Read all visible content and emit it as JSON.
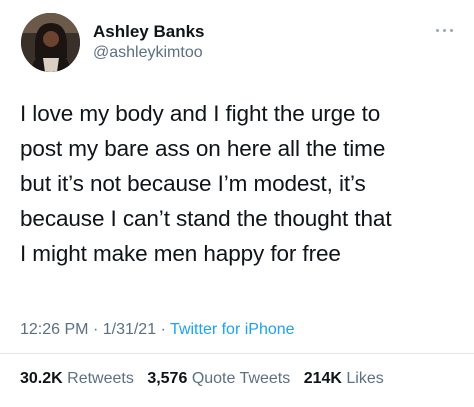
{
  "tweet": {
    "author": {
      "name": "Ashley Banks",
      "handle": "@ashleykimtoo",
      "avatar": "user-avatar"
    },
    "text_lines": [
      "I love my body and I fight the urge to",
      "post my bare ass on here all the time",
      "but it’s not because I’m modest, it’s",
      "because I can’t stand the thought that",
      "I might make men happy for free"
    ],
    "time": "12:26 PM",
    "date": "1/31/21",
    "separator": "·",
    "source": "Twitter for iPhone",
    "stats": {
      "retweets_count": "30.2K",
      "retweets_label": "Retweets",
      "quotes_count": "3,576",
      "quotes_label": "Quote Tweets",
      "likes_count": "214K",
      "likes_label": "Likes"
    }
  },
  "colors": {
    "text": "#0f1419",
    "secondary": "#5b7083",
    "link": "#1da1f2",
    "divider": "#e1e8ed"
  },
  "icons": {
    "more": "more-horizontal-icon"
  }
}
